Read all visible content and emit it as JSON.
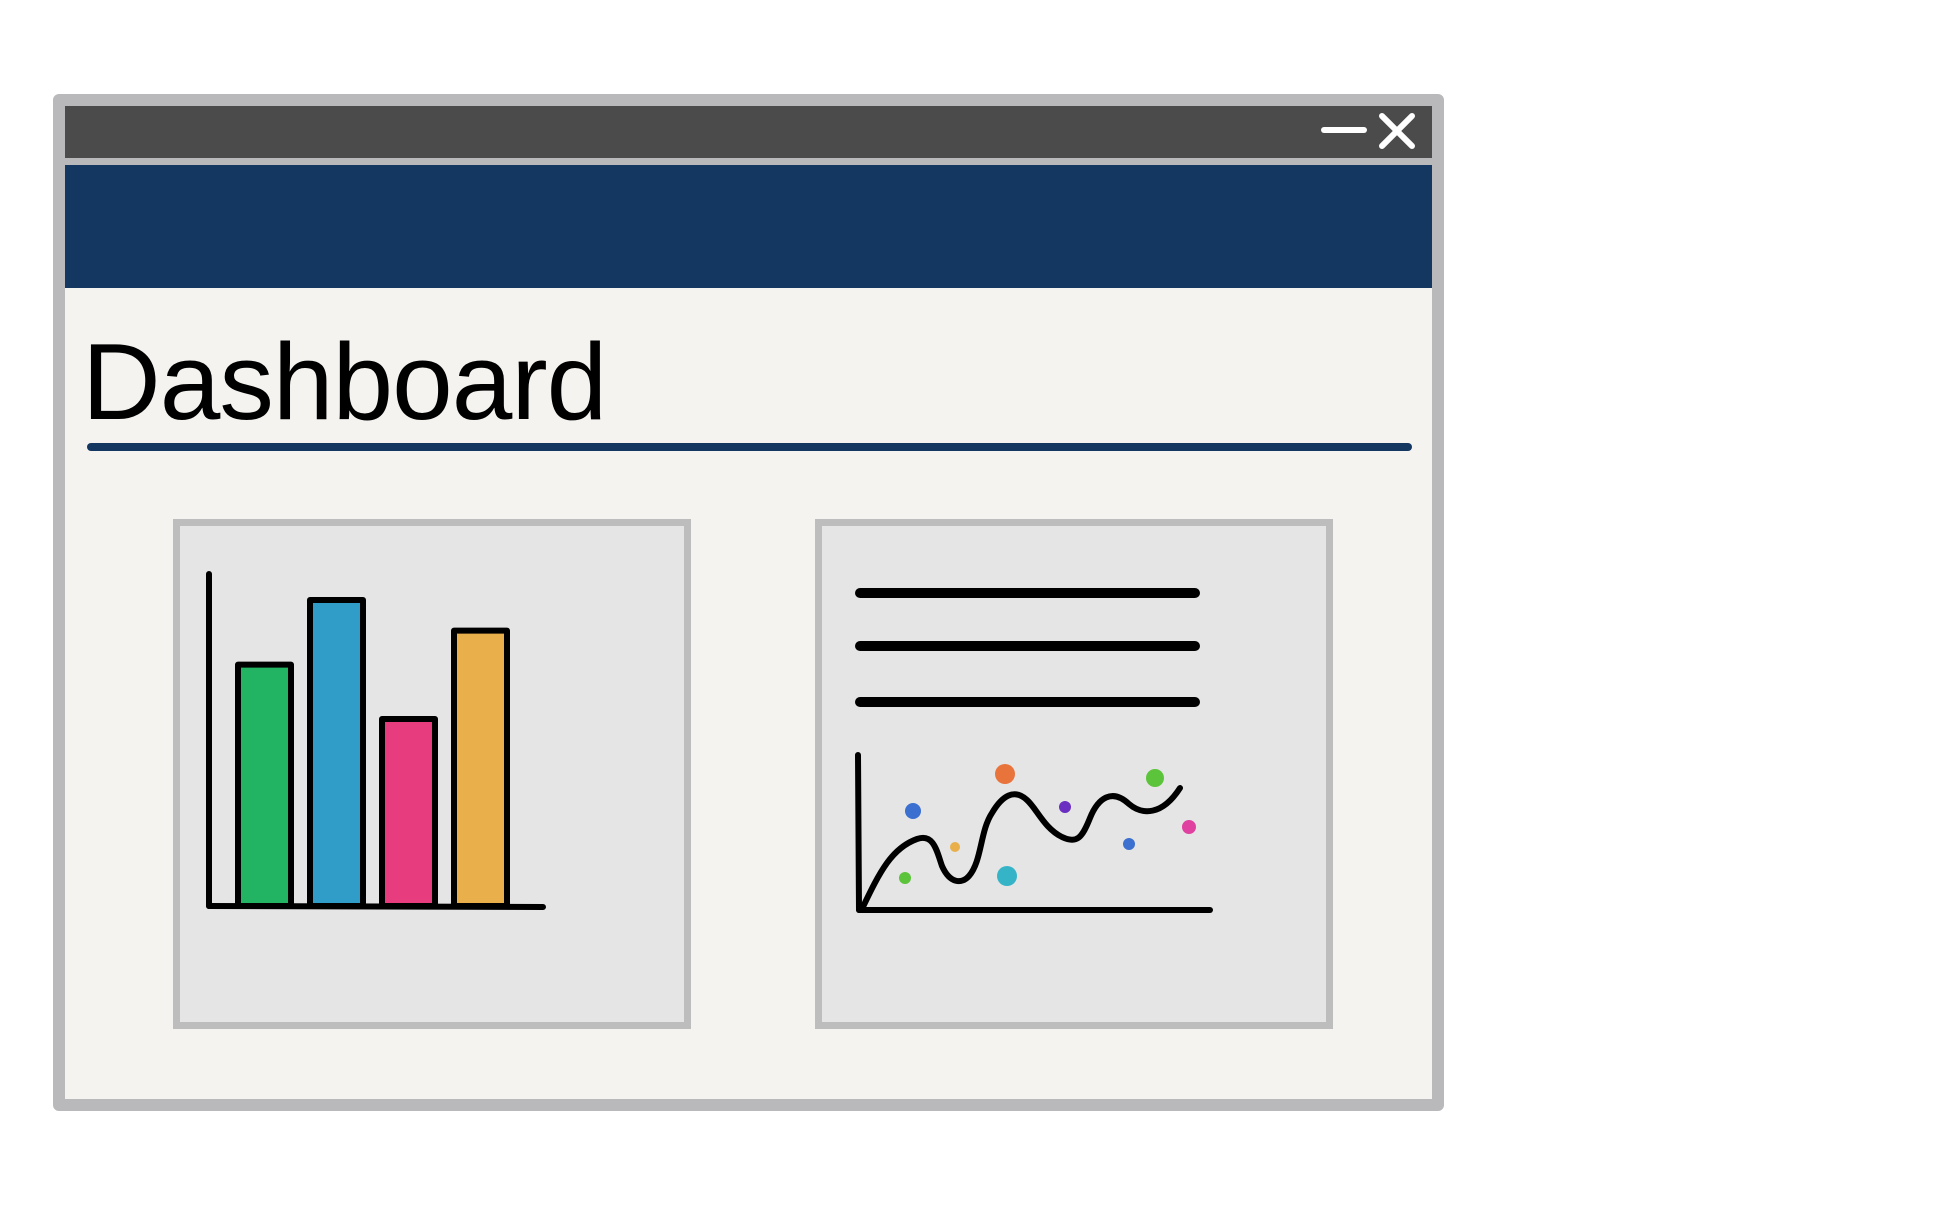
{
  "window": {
    "title_bar": {
      "controls": [
        {
          "name": "minimize",
          "icon": "minimize-icon"
        },
        {
          "name": "close",
          "icon": "close-icon"
        }
      ]
    },
    "banner_color": "#143761"
  },
  "page": {
    "title": "Dashboard"
  },
  "cards": {
    "bar_chart_card": {
      "icon": "bar-chart-icon",
      "bar_colors": [
        "#22b462",
        "#309dc9",
        "#e73c7e",
        "#e8af4b"
      ],
      "bar_levels": [
        0.71,
        0.9,
        0.55,
        0.81
      ]
    },
    "report_card": {
      "icon": "line-chart-icon",
      "text_lines": 3,
      "dot_colors": [
        "#3b6fd0",
        "#5bc43a",
        "#e8af4b",
        "#e8743b",
        "#35b4c8",
        "#6a2fc0",
        "#5bc43a",
        "#3b6fd0",
        "#e040a0"
      ]
    }
  },
  "colors": {
    "titlebar": "#4b4b4b",
    "window_frame": "#b9b9bb",
    "content_bg": "#f4f3f0",
    "accent": "#143761"
  }
}
